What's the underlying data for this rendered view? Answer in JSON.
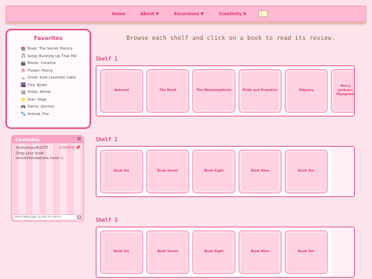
{
  "nav": {
    "items": [
      {
        "label": "Home",
        "caret": ""
      },
      {
        "label": "About",
        "caret": "▼"
      },
      {
        "label": "Excursions",
        "caret": "▼"
      },
      {
        "label": "Creativity",
        "caret": "▼"
      }
    ],
    "theme_icon": "moon-icon"
  },
  "favorites": {
    "title": "Favorites",
    "items": [
      {
        "icon": "📚",
        "label": "Book: The Secret History"
      },
      {
        "icon": "🎵",
        "label": "Song: Running Up That Hill"
      },
      {
        "icon": "🎬",
        "label": "Movie: Coraline"
      },
      {
        "icon": "🌸",
        "label": "Flower: Peony"
      },
      {
        "icon": "☕",
        "label": "Drink: Iced Lavender Latte"
      },
      {
        "icon": "🌆",
        "label": "City: Kyoto"
      },
      {
        "icon": "🖼",
        "label": "Artist: Alfred"
      },
      {
        "icon": "⭐",
        "label": "Star: Vega"
      },
      {
        "icon": "🎮",
        "label": "Game: Journey"
      },
      {
        "icon": "🐾",
        "label": "Animal: Fox"
      }
    ]
  },
  "chat": {
    "title": "Chattable",
    "user": "Anonymous#1075",
    "owner_tag": "[OWNER]",
    "message": "Drop your book recommendations here! c:",
    "input_placeholder": "Send Message (Enter to send)"
  },
  "main": {
    "instructions": "Browse each shelf and click on a book to read its review.",
    "shelves": [
      {
        "title": "Shelf 1",
        "books": [
          "Beloved",
          "The Road",
          "The Metamorphosis",
          "Pride and Prejudice",
          "Odyssey",
          "Percy Jackson: Olympians"
        ]
      },
      {
        "title": "Shelf 2",
        "books": [
          "Book Six",
          "Book Seven",
          "Book Eight",
          "Book Nine",
          "Book Ten"
        ]
      },
      {
        "title": "Shelf 3",
        "books": [
          "Book Six",
          "Book Seven",
          "Book Eight",
          "Book Nine",
          "Book Ten"
        ]
      }
    ]
  },
  "colors": {
    "accent": "#e3457f",
    "nav_bg": "#ffb9d2",
    "book_bg": "#ffd2e0",
    "page_bg": "#fde3ea"
  }
}
